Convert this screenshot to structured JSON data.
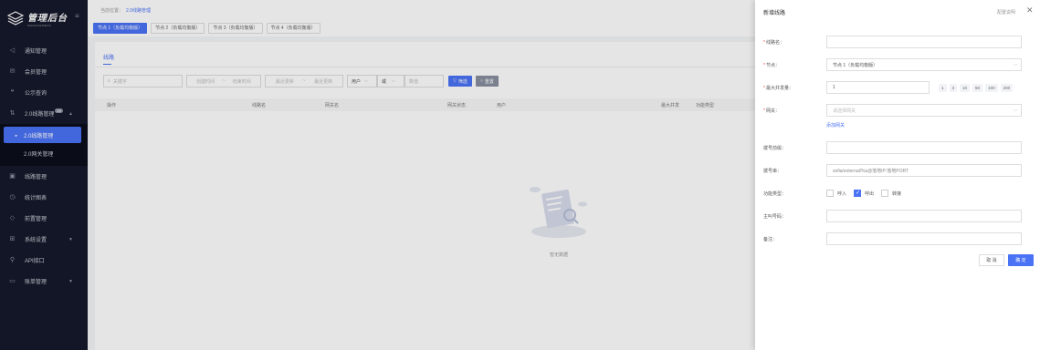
{
  "sidebar": {
    "logo_title": "管理后台",
    "logo_subtitle": "MANAGEMENT",
    "items": [
      {
        "label": "通知管理",
        "icon": "speaker-icon"
      },
      {
        "label": "会员管理",
        "icon": "envelope-icon"
      },
      {
        "label": "公示查询",
        "icon": "quote-icon"
      },
      {
        "label": "2.0线路管理",
        "icon": "sort-icon",
        "badge": "20"
      },
      {
        "label": "线路管理",
        "icon": "monitor-icon"
      },
      {
        "label": "统计图表",
        "icon": "clock-icon"
      },
      {
        "label": "前置管理",
        "icon": "tag-icon"
      },
      {
        "label": "系统设置",
        "icon": "grid-icon"
      },
      {
        "label": "API接口",
        "icon": "plug-icon"
      },
      {
        "label": "账单管理",
        "icon": "wallet-icon"
      }
    ],
    "sub_items": [
      {
        "label": "2.0线路管理"
      },
      {
        "label": "2.0网关管理"
      }
    ]
  },
  "main": {
    "breadcrumb_prefix": "当前位置：",
    "breadcrumb_current": "2.0线路管理",
    "tabs": [
      {
        "label": "节点 1（负载均衡版）"
      },
      {
        "label": "节点 2（负载均衡版）"
      },
      {
        "label": "节点 3（负载均衡版）"
      },
      {
        "label": "节点 4（负载均衡版）"
      }
    ],
    "card_tab": "线路",
    "filter": {
      "keyword_placeholder": "关键字",
      "start_time": "创建时间",
      "range_sep": "~",
      "end_time": "结束时间",
      "start_update": "最近更新",
      "end_update": "最近更新",
      "type_value": "用户",
      "sub_value": "或",
      "value_placeholder": "数值",
      "filter_button": "筛选",
      "reset_button": "重置"
    },
    "columns": [
      "操作",
      "线路名",
      "网关名",
      "网关状态",
      "用户",
      "最大并发",
      "功能类型"
    ],
    "empty_text": "暂无数据"
  },
  "drawer": {
    "title": "新增线路",
    "reset_link": "配置说明",
    "fields": {
      "line_name_label": "线路名：",
      "node_label": "节点：",
      "node_value": "节点 1（负载均衡版）",
      "max_concurrency_label": "最大并发量：",
      "max_concurrency_value": "1",
      "concurrency_options": [
        "1",
        "3",
        "10",
        "50",
        "100",
        "200"
      ],
      "gateway_label": "网关：",
      "gateway_placeholder": "请选择网关",
      "add_gateway_link": "添加网关",
      "prefix_label": "拨号前缀：",
      "dial_label": "拨号串：",
      "dial_value": "sofia/external/%s@落地IP:落地PORT",
      "function_label": "功能类型：",
      "options": [
        {
          "label": "呼入",
          "checked": false
        },
        {
          "label": "呼出",
          "checked": true
        },
        {
          "label": "转接",
          "checked": false
        }
      ],
      "caller_label": "主叫号码：",
      "remark_label": "备注："
    },
    "cancel_button": "取 消",
    "ok_button": "确 定"
  }
}
